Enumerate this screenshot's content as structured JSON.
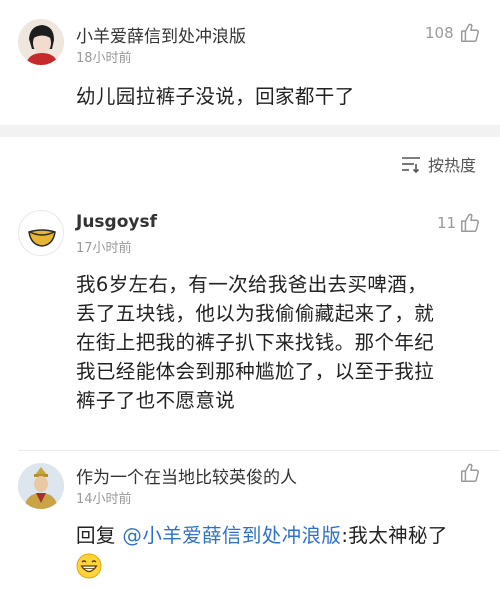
{
  "comments": [
    {
      "username": "小羊爱薛信到处冲浪版",
      "time": "18小时前",
      "likes": "108",
      "text": "幼儿园拉裤子没说，回家都干了"
    },
    {
      "username": "Jusgoysf",
      "time": "17小时前",
      "likes": "11",
      "text_lines": [
        "我6岁左右，有一次给我爸出去买啤酒，",
        "丢了五块钱，他以为我偷偷藏起来了，就",
        "在街上把我的裤子扒下来找钱。那个年纪",
        "我已经能体会到那种尴尬了，以至于我拉",
        "裤子了也不愿意说"
      ]
    },
    {
      "username": "作为一个在当地比较英俊的人",
      "time": "14小时前",
      "likes": "",
      "reply_prefix": "回复",
      "mention": "@小羊爱薛信到处冲浪版",
      "reply_rest": ":我太神秘了"
    }
  ],
  "sort": {
    "label": "按热度",
    "icon": "sort-lines-icon"
  },
  "colors": {
    "link": "#2e72c7",
    "meta": "#9a9a9a",
    "separator": "#f2f2f2"
  }
}
